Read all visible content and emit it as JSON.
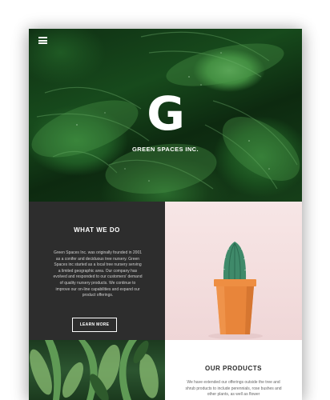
{
  "nav": {
    "menu_icon": "hamburger-menu-icon"
  },
  "hero": {
    "logo_letter": "G",
    "brand_name": "GREEN SPACES INC."
  },
  "what_we_do": {
    "heading": "WHAT WE DO",
    "body": "Green Spaces Inc. was originally founded in 2001 as a conifer and deciduous tree nursery. Green Spaces inc started as a local tree nursery serving a limited geographic area. Our company has evolved and responded to our customers' demand of quality nursery products. We continue to improve our on-line capabilities and expand our product offerings.",
    "button_label": "LEARN MORE"
  },
  "our_products": {
    "heading": "OUR PRODUCTS",
    "body": "We have extended our offerings outside the tree and shrub products to include perennials, rose bushes and other plants, as well as flower"
  },
  "colors": {
    "dark_panel": "#2d2d2d",
    "pink_panel": "#f3dddd",
    "pot_orange": "#e8853a",
    "cactus_green": "#3f8a6a"
  }
}
